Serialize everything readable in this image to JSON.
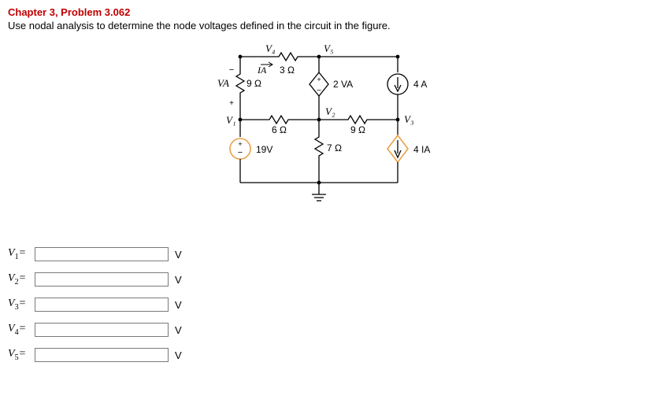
{
  "header": {
    "chapter_label": "Chapter 3, Problem 3.062",
    "problem_statement": "Use nodal analysis to determine the node voltages defined in the circuit in the figure."
  },
  "circuit": {
    "nodes": {
      "v1": "V₁",
      "v2": "V₂",
      "v3": "V₃",
      "v4": "V₄",
      "v5": "V₅"
    },
    "resistors": {
      "r_top": "3 Ω",
      "r_left": "9  Ω",
      "r_mid_left": "6 Ω",
      "r_mid_right": "9 Ω",
      "r_bottom": "7 Ω"
    },
    "sources": {
      "dep_v": "2 VA",
      "i_right": "4 A",
      "v_left": "19V",
      "dep_i": "4 IA"
    },
    "labels": {
      "ia": "IA",
      "va": "VA",
      "plus": "+",
      "minus": "−"
    }
  },
  "answers": {
    "unit": "V",
    "rows": [
      {
        "name": "V1",
        "html_label": "V<sub>1</sub>="
      },
      {
        "name": "V2",
        "html_label": "V<sub>2</sub>="
      },
      {
        "name": "V3",
        "html_label": "V<sub>3</sub>="
      },
      {
        "name": "V4",
        "html_label": "V<sub>4</sub>="
      },
      {
        "name": "V5",
        "html_label": "V<sub>5</sub>="
      }
    ]
  }
}
